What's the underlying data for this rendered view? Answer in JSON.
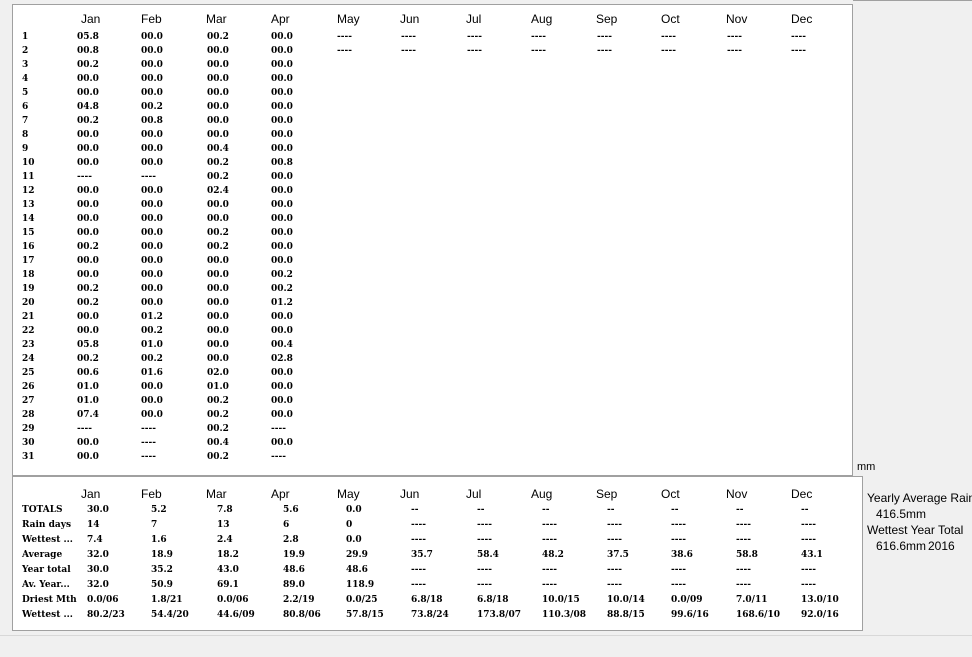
{
  "months": [
    "Jan",
    "Feb",
    "Mar",
    "Apr",
    "May",
    "Jun",
    "Jul",
    "Aug",
    "Sep",
    "Oct",
    "Nov",
    "Dec"
  ],
  "daily": [
    [
      "05.8",
      "00.0",
      "00.2",
      "00.0",
      "----",
      "----",
      "----",
      "----",
      "----",
      "----",
      "----",
      "----"
    ],
    [
      "00.8",
      "00.0",
      "00.0",
      "00.0",
      "----",
      "----",
      "----",
      "----",
      "----",
      "----",
      "----",
      "----"
    ],
    [
      "00.2",
      "00.0",
      "00.0",
      "00.0",
      "",
      "",
      "",
      "",
      "",
      "",
      "",
      ""
    ],
    [
      "00.0",
      "00.0",
      "00.0",
      "00.0",
      "",
      "",
      "",
      "",
      "",
      "",
      "",
      ""
    ],
    [
      "00.0",
      "00.0",
      "00.0",
      "00.0",
      "",
      "",
      "",
      "",
      "",
      "",
      "",
      ""
    ],
    [
      "04.8",
      "00.2",
      "00.0",
      "00.0",
      "",
      "",
      "",
      "",
      "",
      "",
      "",
      ""
    ],
    [
      "00.2",
      "00.8",
      "00.0",
      "00.0",
      "",
      "",
      "",
      "",
      "",
      "",
      "",
      ""
    ],
    [
      "00.0",
      "00.0",
      "00.0",
      "00.0",
      "",
      "",
      "",
      "",
      "",
      "",
      "",
      ""
    ],
    [
      "00.0",
      "00.0",
      "00.4",
      "00.0",
      "",
      "",
      "",
      "",
      "",
      "",
      "",
      ""
    ],
    [
      "00.0",
      "00.0",
      "00.2",
      "00.8",
      "",
      "",
      "",
      "",
      "",
      "",
      "",
      ""
    ],
    [
      "----",
      "----",
      "00.2",
      "00.0",
      "",
      "",
      "",
      "",
      "",
      "",
      "",
      ""
    ],
    [
      "00.0",
      "00.0",
      "02.4",
      "00.0",
      "",
      "",
      "",
      "",
      "",
      "",
      "",
      ""
    ],
    [
      "00.0",
      "00.0",
      "00.0",
      "00.0",
      "",
      "",
      "",
      "",
      "",
      "",
      "",
      ""
    ],
    [
      "00.0",
      "00.0",
      "00.0",
      "00.0",
      "",
      "",
      "",
      "",
      "",
      "",
      "",
      ""
    ],
    [
      "00.0",
      "00.0",
      "00.2",
      "00.0",
      "",
      "",
      "",
      "",
      "",
      "",
      "",
      ""
    ],
    [
      "00.2",
      "00.0",
      "00.2",
      "00.0",
      "",
      "",
      "",
      "",
      "",
      "",
      "",
      ""
    ],
    [
      "00.0",
      "00.0",
      "00.0",
      "00.0",
      "",
      "",
      "",
      "",
      "",
      "",
      "",
      ""
    ],
    [
      "00.0",
      "00.0",
      "00.0",
      "00.2",
      "",
      "",
      "",
      "",
      "",
      "",
      "",
      ""
    ],
    [
      "00.2",
      "00.0",
      "00.0",
      "00.2",
      "",
      "",
      "",
      "",
      "",
      "",
      "",
      ""
    ],
    [
      "00.2",
      "00.0",
      "00.0",
      "01.2",
      "",
      "",
      "",
      "",
      "",
      "",
      "",
      ""
    ],
    [
      "00.0",
      "01.2",
      "00.0",
      "00.0",
      "",
      "",
      "",
      "",
      "",
      "",
      "",
      ""
    ],
    [
      "00.0",
      "00.2",
      "00.0",
      "00.0",
      "",
      "",
      "",
      "",
      "",
      "",
      "",
      ""
    ],
    [
      "05.8",
      "01.0",
      "00.0",
      "00.4",
      "",
      "",
      "",
      "",
      "",
      "",
      "",
      ""
    ],
    [
      "00.2",
      "00.2",
      "00.0",
      "02.8",
      "",
      "",
      "",
      "",
      "",
      "",
      "",
      ""
    ],
    [
      "00.6",
      "01.6",
      "02.0",
      "00.0",
      "",
      "",
      "",
      "",
      "",
      "",
      "",
      ""
    ],
    [
      "01.0",
      "00.0",
      "01.0",
      "00.0",
      "",
      "",
      "",
      "",
      "",
      "",
      "",
      ""
    ],
    [
      "01.0",
      "00.0",
      "00.2",
      "00.0",
      "",
      "",
      "",
      "",
      "",
      "",
      "",
      ""
    ],
    [
      "07.4",
      "00.0",
      "00.2",
      "00.0",
      "",
      "",
      "",
      "",
      "",
      "",
      "",
      ""
    ],
    [
      "----",
      "----",
      "00.2",
      "----",
      "",
      "",
      "",
      "",
      "",
      "",
      "",
      ""
    ],
    [
      "00.0",
      "----",
      "00.4",
      "00.0",
      "",
      "",
      "",
      "",
      "",
      "",
      "",
      ""
    ],
    [
      "00.0",
      "----",
      "00.2",
      "----",
      "",
      "",
      "",
      "",
      "",
      "",
      "",
      ""
    ]
  ],
  "unit_label": "mm",
  "summary_rows": [
    {
      "label": "TOTALS",
      "values": [
        "30.0",
        "5.2",
        "7.8",
        "5.6",
        "0.0",
        "--",
        "--",
        "--",
        "--",
        "--",
        "--",
        "--"
      ]
    },
    {
      "label": "Rain days",
      "values": [
        "14",
        "7",
        "13",
        "6",
        "0",
        "----",
        "----",
        "----",
        "----",
        "----",
        "----",
        "----"
      ]
    },
    {
      "label": "Wettest ...",
      "values": [
        "7.4",
        "1.6",
        "2.4",
        "2.8",
        "0.0",
        "----",
        "----",
        "----",
        "----",
        "----",
        "----",
        "----"
      ]
    },
    {
      "label": "Average",
      "values": [
        "32.0",
        "18.9",
        "18.2",
        "19.9",
        "29.9",
        "35.7",
        "58.4",
        "48.2",
        "37.5",
        "38.6",
        "58.8",
        "43.1"
      ]
    },
    {
      "label": "Year total",
      "values": [
        "30.0",
        "35.2",
        "43.0",
        "48.6",
        "48.6",
        "----",
        "----",
        "----",
        "----",
        "----",
        "----",
        "----"
      ]
    },
    {
      "label": "Av. Year...",
      "values": [
        "32.0",
        "50.9",
        "69.1",
        "89.0",
        "118.9",
        "----",
        "----",
        "----",
        "----",
        "----",
        "----",
        "----"
      ]
    },
    {
      "label": "Driest Mth",
      "values": [
        "0.0/06",
        "1.8/21",
        "0.0/06",
        "2.2/19",
        "0.0/25",
        "6.8/18",
        "6.8/18",
        "10.0/15",
        "10.0/14",
        "0.0/09",
        "7.0/11",
        "13.0/10"
      ]
    },
    {
      "label": "Wettest ...",
      "values": [
        "80.2/23",
        "54.4/20",
        "44.6/09",
        "80.8/06",
        "57.8/15",
        "73.8/24",
        "173.8/07",
        "110.3/08",
        "88.8/15",
        "99.6/16",
        "168.6/10",
        "92.0/16"
      ]
    }
  ],
  "sidebar": {
    "yearly_avg_label": "Yearly Average Rain",
    "yearly_avg_value": "416.5mm",
    "wettest_year_label": "Wettest Year Total",
    "wettest_year_value": "616.6mm",
    "wettest_year": "2016"
  }
}
